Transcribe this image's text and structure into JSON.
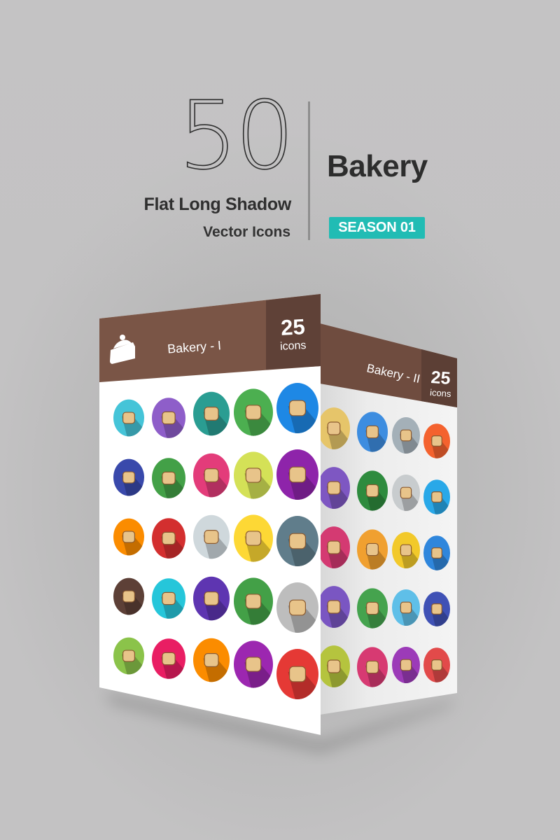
{
  "hero": {
    "count": "50",
    "style_line": "Flat Long Shadow",
    "type_line": "Vector Icons",
    "category": "Bakery",
    "season_badge": "SEASON 01"
  },
  "colors": {
    "header_brown": "#7a5546",
    "header_brown_dark": "#5f4137",
    "season_teal": "#21bcb4",
    "text_dark": "#2e2e2e"
  },
  "panels": [
    {
      "title": "Bakery - I",
      "count": "25",
      "count_label": "icons",
      "header_icon": "cake-slice-icon",
      "icons": [
        {
          "name": "bread-loaf-icon",
          "color": "#45c4d8"
        },
        {
          "name": "cupcake-icon",
          "color": "#8e5ec9"
        },
        {
          "name": "pretzel-icon",
          "color": "#2a9d92"
        },
        {
          "name": "donut-icon",
          "color": "#4caf50"
        },
        {
          "name": "bread-bun-icon",
          "color": "#1e88e5"
        },
        {
          "name": "muffin-icon",
          "color": "#3949ab"
        },
        {
          "name": "toast-slice-icon",
          "color": "#43a047"
        },
        {
          "name": "croissant-icon",
          "color": "#e33c7a"
        },
        {
          "name": "layer-cake-icon",
          "color": "#d4e157"
        },
        {
          "name": "swiss-roll-icon",
          "color": "#8e24aa"
        },
        {
          "name": "cake-piece-icon",
          "color": "#fb8c00"
        },
        {
          "name": "sliced-bread-icon",
          "color": "#d32f2f"
        },
        {
          "name": "rolling-pin-icon",
          "color": "#cfd8dc"
        },
        {
          "name": "gingerbread-man-icon",
          "color": "#fdd835"
        },
        {
          "name": "ice-cupcake-icon",
          "color": "#607d8b"
        },
        {
          "name": "wheat-icon",
          "color": "#5d4037"
        },
        {
          "name": "baguette-icon",
          "color": "#26c6da"
        },
        {
          "name": "dough-rolling-icon",
          "color": "#5e35b1"
        },
        {
          "name": "brick-oven-icon",
          "color": "#43a047"
        },
        {
          "name": "pizza-slice-icon",
          "color": "#bdbdbd"
        },
        {
          "name": "stand-mixer-icon",
          "color": "#8bc34a"
        },
        {
          "name": "pie-dish-icon",
          "color": "#e91e63"
        },
        {
          "name": "mixing-bowl-icon",
          "color": "#fb8c00"
        },
        {
          "name": "bakery-shop-icon",
          "color": "#9c27b0"
        },
        {
          "name": "flour-sack-icon",
          "color": "#e53935"
        }
      ]
    },
    {
      "title": "Bakery - II",
      "count": "25",
      "count_label": "icons",
      "icons": [
        {
          "name": "round-loaf-icon",
          "color": "#e6c56a"
        },
        {
          "name": "sliced-loaf-icon",
          "color": "#3d8de0"
        },
        {
          "name": "hot-dog-buns-icon",
          "color": "#a4b0b8"
        },
        {
          "name": "scoop-icon",
          "color": "#f4622e"
        },
        {
          "name": "danish-pastry-icon",
          "color": "#7e57c2"
        },
        {
          "name": "cracker-icon",
          "color": "#2e8b3e"
        },
        {
          "name": "cinnamon-roll-icon",
          "color": "#c8ccce"
        },
        {
          "name": "cherry-cake-icon",
          "color": "#29a8e8"
        },
        {
          "name": "eggs-icon",
          "color": "#d43a72"
        },
        {
          "name": "cherries-icon",
          "color": "#f0a030"
        },
        {
          "name": "strawberry-icon",
          "color": "#f2c92a"
        },
        {
          "name": "oven-icon",
          "color": "#2f86dc"
        },
        {
          "name": "cookie-icon",
          "color": "#7a56c2"
        },
        {
          "name": "croissants-icon",
          "color": "#45a34e"
        },
        {
          "name": "brownies-icon",
          "color": "#5fbfe8"
        },
        {
          "name": "baker-chef-icon",
          "color": "#3f51b5"
        },
        {
          "name": "pie-slice-icon",
          "color": "#b5c43e"
        },
        {
          "name": "pancakes-icon",
          "color": "#d73a72"
        },
        {
          "name": "steaming-bun-icon",
          "color": "#9c3bb8"
        },
        {
          "name": "whisk-icon",
          "color": "#e24a4a"
        }
      ]
    }
  ]
}
